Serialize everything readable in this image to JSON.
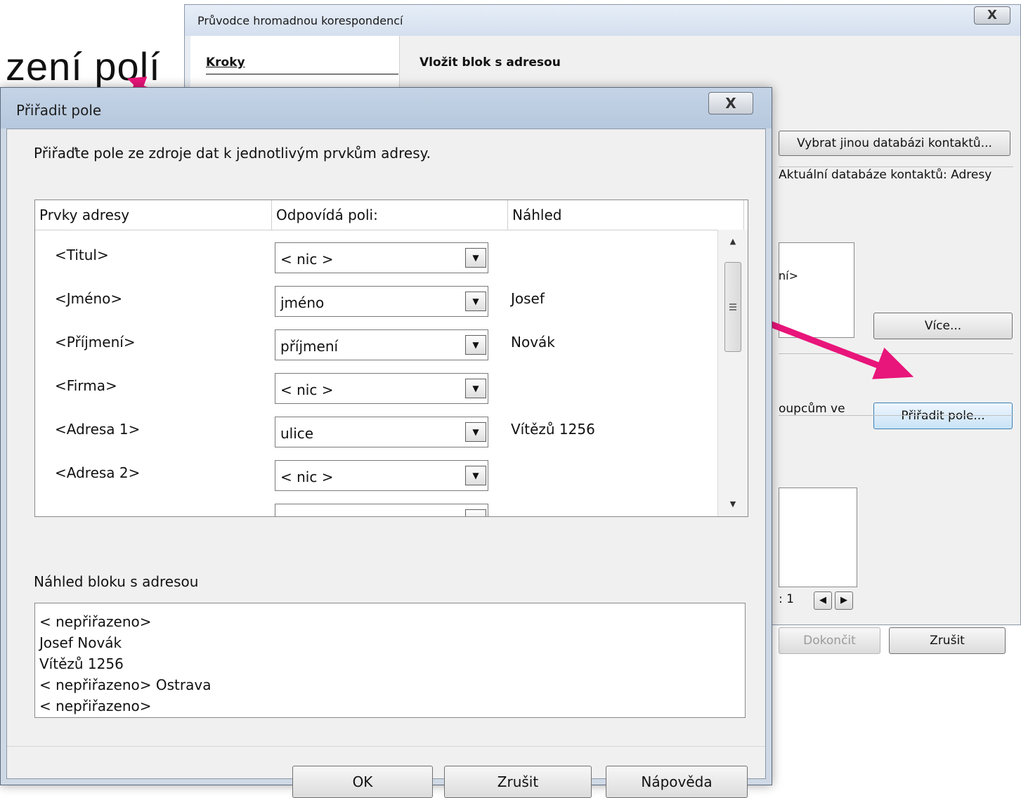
{
  "slide": {
    "title_fragment": "zení polí"
  },
  "wizard": {
    "title": "Průvodce hromadnou korespondencí",
    "close_glyph": "X",
    "steps_heading": "Kroky",
    "section_heading": "Vložit blok s adresou",
    "select_db_button": "Vybrat jinou databázi kontaktů...",
    "current_db_label": "Aktuální databáze kontaktů: Adresy",
    "address_preview_fragment": "ní>",
    "more_button": "Více...",
    "match_label_fragment": "oupcům ve",
    "match_fields_button": "Přiřadit pole...",
    "doc_counter_fragment": ": 1",
    "finish_button": "Dokončit",
    "cancel_button": "Zrušit"
  },
  "dialog": {
    "title": "Přiřadit pole",
    "close_glyph": "X",
    "instruction": "Přiřaďte pole ze zdroje dat k jednotlivým prvkům adresy.",
    "columns": {
      "elements": "Prvky adresy",
      "match": "Odpovídá poli:",
      "preview": "Náhled"
    },
    "rows": [
      {
        "element": "<Titul>",
        "field": "< nic >",
        "preview": ""
      },
      {
        "element": "<Jméno>",
        "field": "jméno",
        "preview": "Josef"
      },
      {
        "element": "<Příjmení>",
        "field": "příjmení",
        "preview": "Novák"
      },
      {
        "element": "<Firma>",
        "field": "< nic >",
        "preview": ""
      },
      {
        "element": "<Adresa 1>",
        "field": "ulice",
        "preview": "Vítězů 1256"
      },
      {
        "element": "<Adresa 2>",
        "field": "< nic >",
        "preview": ""
      }
    ],
    "preview_label": "Náhled bloku s adresou",
    "preview_lines": [
      "< nepřiřazeno>",
      "Josef Novák",
      "Vítězů 1256",
      "< nepřiřazeno> Ostrava",
      "< nepřiřazeno>"
    ],
    "ok_button": "OK",
    "cancel_button": "Zrušit",
    "help_button": "Nápověda"
  },
  "colors": {
    "arrow": "#e8157a",
    "dialog_frame": "#cfd9e6",
    "window_bg": "#f0f0f0"
  }
}
